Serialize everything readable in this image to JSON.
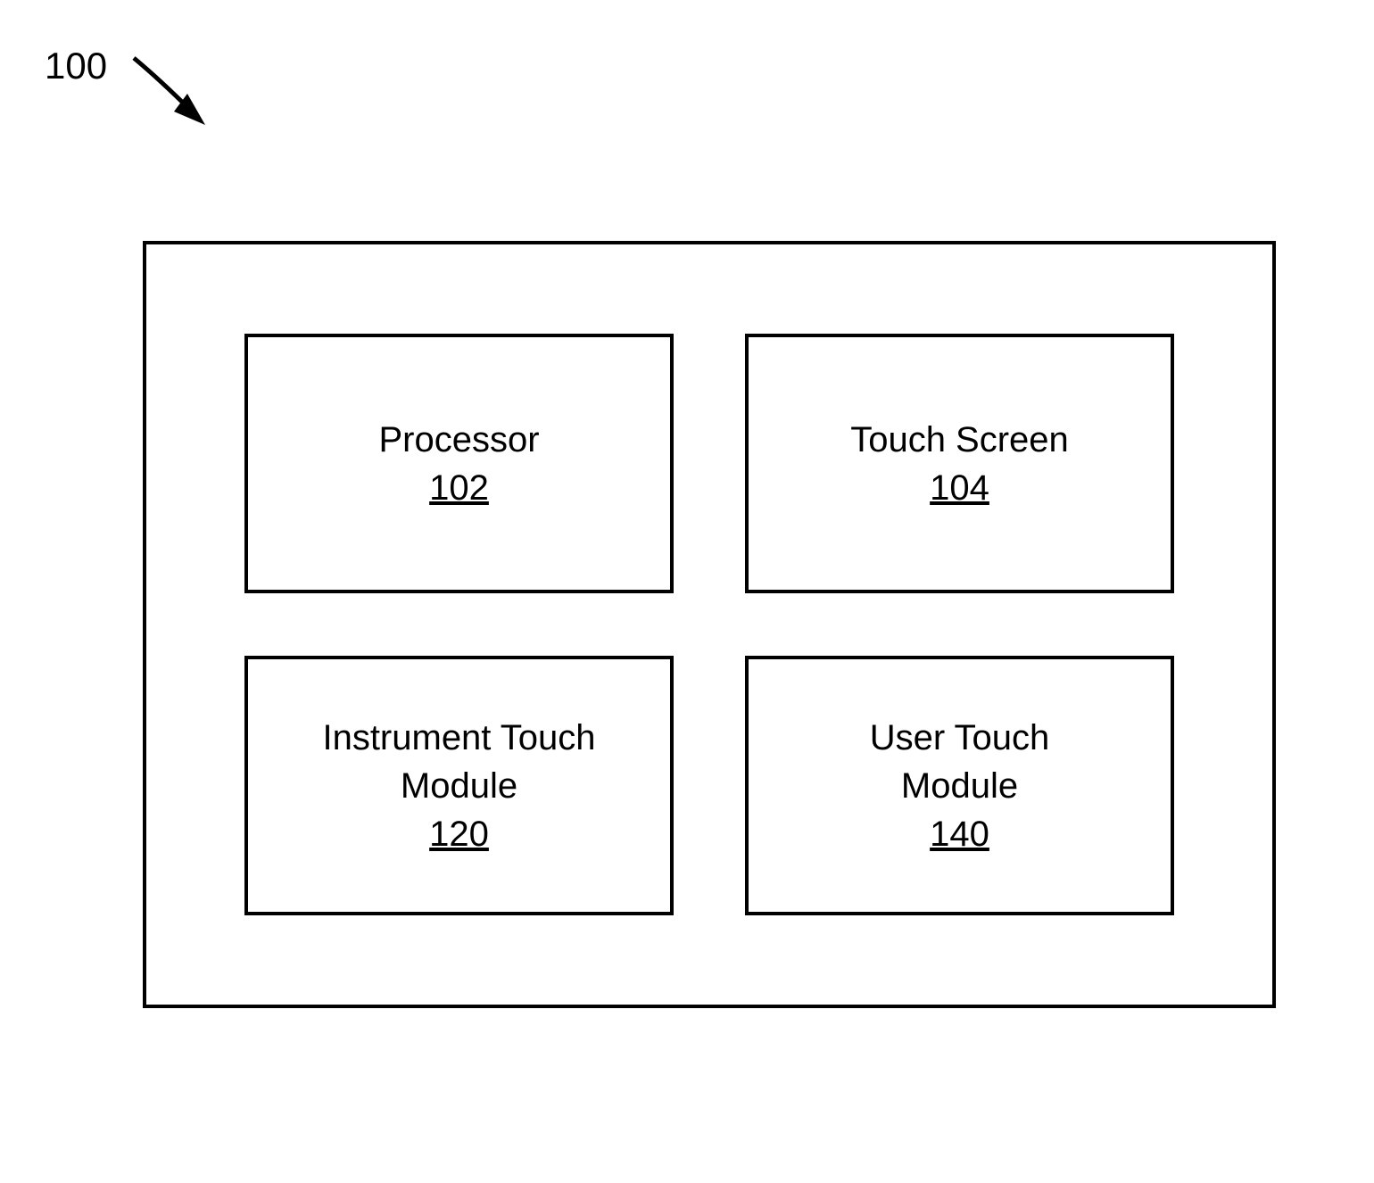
{
  "reference": {
    "label": "100"
  },
  "blocks": {
    "processor": {
      "title": "Processor",
      "number": "102"
    },
    "touchScreen": {
      "title": "Touch Screen",
      "number": "104"
    },
    "instrumentTouch": {
      "title_line1": "Instrument Touch",
      "title_line2": "Module",
      "number": "120"
    },
    "userTouch": {
      "title_line1": "User Touch",
      "title_line2": "Module",
      "number": "140"
    }
  }
}
